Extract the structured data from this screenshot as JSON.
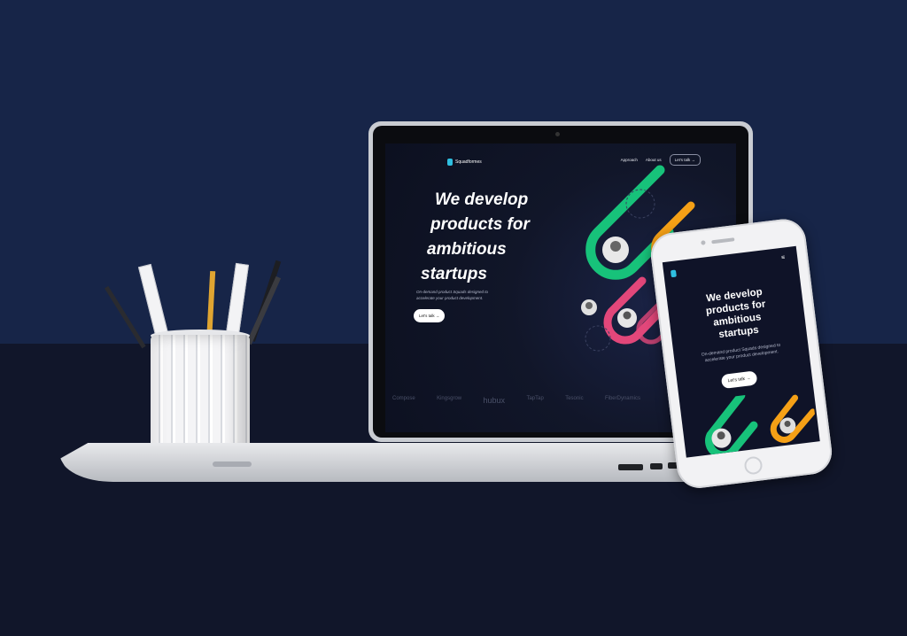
{
  "colors": {
    "wall": "#172548",
    "table": "#11162a",
    "accent_green": "#17c27a",
    "accent_orange": "#f5a016",
    "accent_pink": "#e2477a",
    "accent_blue": "#3b5bd9"
  },
  "laptop_site": {
    "brand": "Squadformes",
    "nav": {
      "approach": "Approach",
      "about": "About us",
      "cta": "Let's talk"
    },
    "headline": [
      "We develop",
      "products for",
      "ambitious",
      "startups"
    ],
    "subtitle": "On-demand product Squads designed to accelerate your product development.",
    "cta": "Let's talk",
    "arrow_icon": "arrow-right-icon",
    "client_logos": [
      "Compose",
      "Kingsgrow",
      "hubux",
      "TapTap",
      "Tesonic",
      "FiberDynamics"
    ]
  },
  "phone_site": {
    "menu_icon": "hamburger-icon",
    "headline": [
      "We develop",
      "products for",
      "ambitious",
      "startups"
    ],
    "subtitle": "On-demand product Squads designed to accelerate your product development.",
    "cta": "Let's talk"
  }
}
